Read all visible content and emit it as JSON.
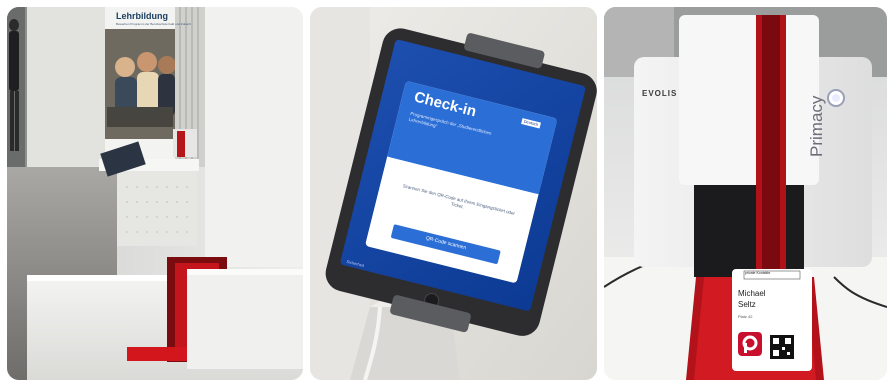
{
  "photos": [
    {
      "poster_title": "Lehrbildung",
      "poster_subtitle": "Bewerben Programm der Berufsschule bald und Zukunft"
    },
    {
      "tablet": {
        "heading": "Check-in",
        "event_title": "Programmgespräch der „Studierendlichen Lehrerbildung“",
        "language": "Deutsch",
        "instruction": "Scannen Sie den QR-Code auf Ihrem Eingangsticket oder Ticket.",
        "button_label": "QR-Code scannen",
        "footer_label": "Sicherheit"
      }
    },
    {
      "printer_brand": "EVOLIS",
      "printer_model": "Primacy",
      "badge": {
        "logo_text": "private Kontakte",
        "first_name": "Michael",
        "last_name": "Seltz",
        "subtitle": "Platz 42"
      }
    }
  ]
}
